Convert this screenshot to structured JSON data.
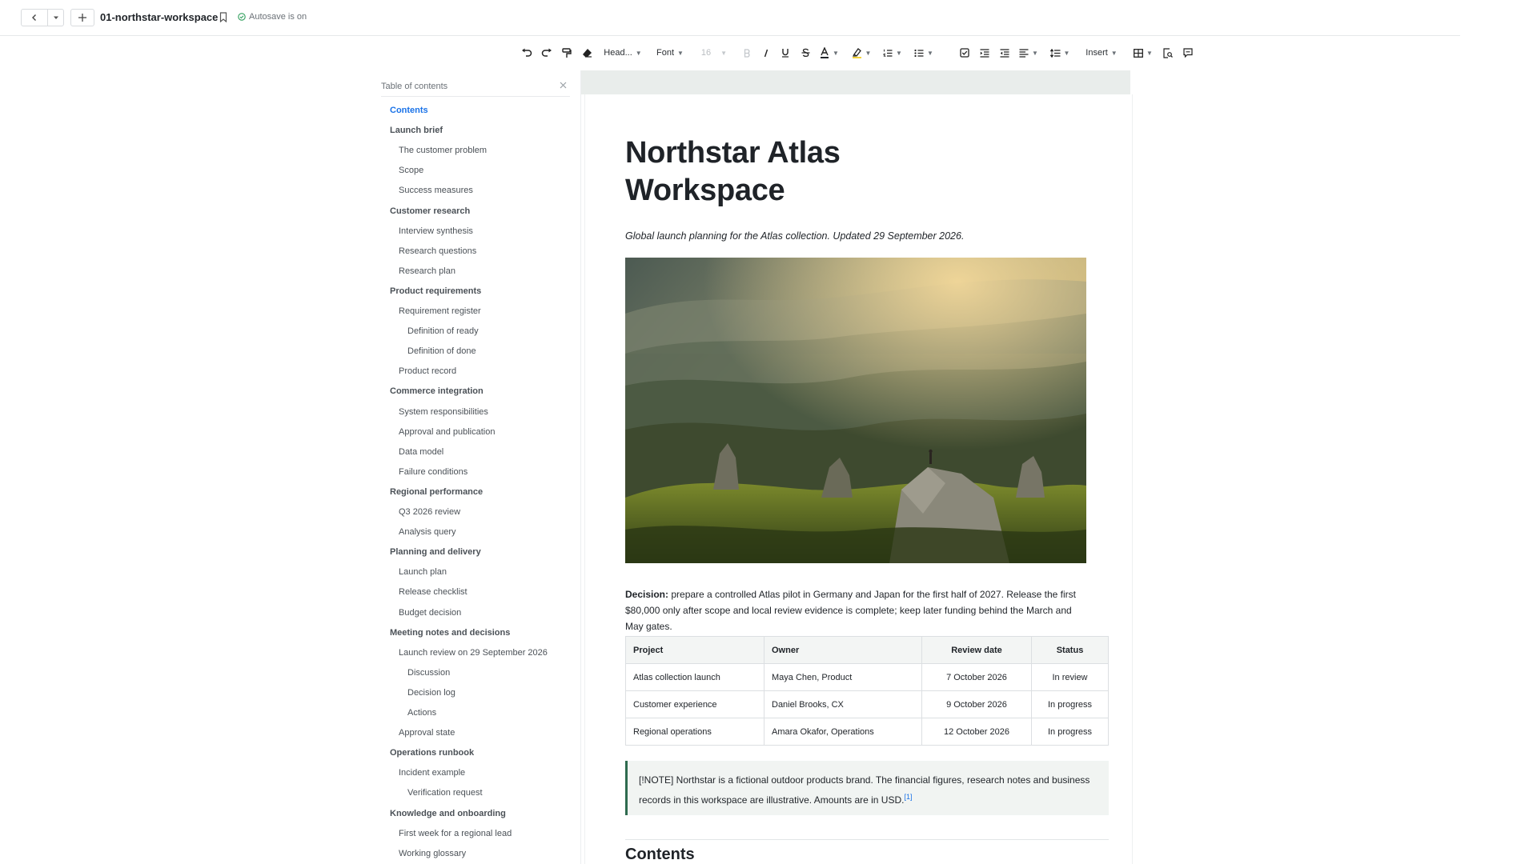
{
  "topbar": {
    "doc_name": "01-northstar-workspace",
    "autosave": "Autosave is on"
  },
  "toolbar": {
    "heading_select": "Head...",
    "font_select": "Font",
    "size_select": "16",
    "insert_menu": "Insert"
  },
  "toc": {
    "title": "Table of contents",
    "items": [
      {
        "label": "Contents",
        "level": 1,
        "active": true
      },
      {
        "label": "Launch brief",
        "level": 1
      },
      {
        "label": "The customer problem",
        "level": 2
      },
      {
        "label": "Scope",
        "level": 2
      },
      {
        "label": "Success measures",
        "level": 2
      },
      {
        "label": "Customer research",
        "level": 1
      },
      {
        "label": "Interview synthesis",
        "level": 2
      },
      {
        "label": "Research questions",
        "level": 2
      },
      {
        "label": "Research plan",
        "level": 2
      },
      {
        "label": "Product requirements",
        "level": 1
      },
      {
        "label": "Requirement register",
        "level": 2
      },
      {
        "label": "Definition of ready",
        "level": 3
      },
      {
        "label": "Definition of done",
        "level": 3
      },
      {
        "label": "Product record",
        "level": 2
      },
      {
        "label": "Commerce integration",
        "level": 1
      },
      {
        "label": "System responsibilities",
        "level": 2
      },
      {
        "label": "Approval and publication",
        "level": 2
      },
      {
        "label": "Data model",
        "level": 2
      },
      {
        "label": "Failure conditions",
        "level": 2
      },
      {
        "label": "Regional performance",
        "level": 1
      },
      {
        "label": "Q3 2026 review",
        "level": 2
      },
      {
        "label": "Analysis query",
        "level": 2
      },
      {
        "label": "Planning and delivery",
        "level": 1
      },
      {
        "label": "Launch plan",
        "level": 2
      },
      {
        "label": "Release checklist",
        "level": 2
      },
      {
        "label": "Budget decision",
        "level": 2
      },
      {
        "label": "Meeting notes and decisions",
        "level": 1
      },
      {
        "label": "Launch review on 29 September 2026",
        "level": 2
      },
      {
        "label": "Discussion",
        "level": 3
      },
      {
        "label": "Decision log",
        "level": 3
      },
      {
        "label": "Actions",
        "level": 3
      },
      {
        "label": "Approval state",
        "level": 2
      },
      {
        "label": "Operations runbook",
        "level": 1
      },
      {
        "label": "Incident example",
        "level": 2
      },
      {
        "label": "Verification request",
        "level": 3
      },
      {
        "label": "Knowledge and onboarding",
        "level": 1
      },
      {
        "label": "First week for a regional lead",
        "level": 2
      },
      {
        "label": "Working glossary",
        "level": 2
      }
    ]
  },
  "doc": {
    "title": "Northstar Atlas Workspace",
    "subtitle": "Global launch planning for the Atlas collection. Updated 29 September 2026.",
    "decision_label": "Decision:",
    "decision_text": " prepare a controlled Atlas pilot in Germany and Japan for the first half of 2027. Release the first $80,000 only after scope and local review evidence is complete; keep later funding behind the March and May gates.",
    "table": {
      "headers": [
        "Project",
        "Owner",
        "Review date",
        "Status"
      ],
      "rows": [
        [
          "Atlas collection launch",
          "Maya Chen, Product",
          "7 October 2026",
          "In review"
        ],
        [
          "Customer experience",
          "Daniel Brooks, CX",
          "9 October 2026",
          "In progress"
        ],
        [
          "Regional operations",
          "Amara Okafor, Operations",
          "12 October 2026",
          "In progress"
        ]
      ]
    },
    "note_text": "[!NOTE] Northstar is a fictional outdoor products brand. The financial figures, research notes and business records in this workspace are illustrative. Amounts are in USD.",
    "note_footnote": "[1]",
    "contents_heading": "Contents"
  },
  "colors": {
    "accent": "#1a73e8",
    "note_border": "#2e6b4f",
    "autosave_ok": "#2e9e5b"
  }
}
